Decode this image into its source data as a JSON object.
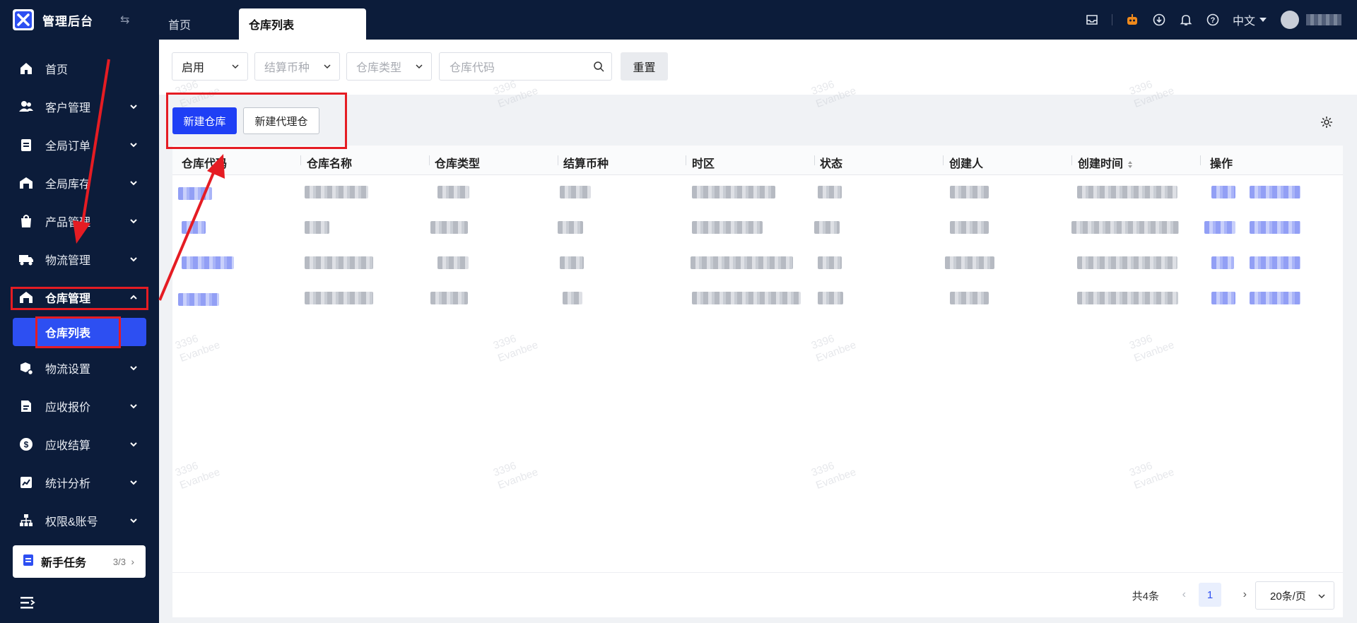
{
  "app": {
    "title": "管理后台",
    "brand_color": "#2d4ff2",
    "sidebar_color": "#0c1c3a"
  },
  "tabs": [
    {
      "label": "首页",
      "active": false
    },
    {
      "label": "仓库列表",
      "active": true
    }
  ],
  "header": {
    "icons": [
      "inbox-icon",
      "robot-icon",
      "download-icon",
      "bell-icon",
      "help-icon"
    ],
    "language": "中文"
  },
  "sidebar": {
    "items": [
      {
        "label": "首页",
        "icon": "home-icon"
      },
      {
        "label": "客户管理",
        "icon": "users-icon"
      },
      {
        "label": "全局订单",
        "icon": "clipboard-icon"
      },
      {
        "label": "全局库存",
        "icon": "warehouse-icon"
      },
      {
        "label": "产品管理",
        "icon": "bag-icon"
      },
      {
        "label": "物流管理",
        "icon": "truck-icon"
      },
      {
        "label": "仓库管理",
        "icon": "warehouse-home-icon",
        "open": true
      },
      {
        "label": "物流设置",
        "icon": "box-settings-icon"
      },
      {
        "label": "应收报价",
        "icon": "document-icon"
      },
      {
        "label": "应收结算",
        "icon": "dollar-icon"
      },
      {
        "label": "统计分析",
        "icon": "chart-icon"
      },
      {
        "label": "权限&账号",
        "icon": "org-icon"
      }
    ],
    "submenu_active": "仓库列表",
    "task_card": {
      "label": "新手任务",
      "count": "3/3"
    }
  },
  "filters": {
    "status": {
      "value": "启用"
    },
    "currency": {
      "placeholder": "结算币种"
    },
    "type": {
      "placeholder": "仓库类型"
    },
    "code": {
      "placeholder": "仓库代码"
    },
    "reset_label": "重置"
  },
  "actions": {
    "new_warehouse": "新建仓库",
    "new_agent_warehouse": "新建代理仓"
  },
  "table": {
    "columns": [
      "仓库代码",
      "仓库名称",
      "仓库类型",
      "结算币种",
      "时区",
      "状态",
      "创建人",
      "创建时间",
      "操作"
    ],
    "row_count": 4
  },
  "pagination": {
    "total": "共4条",
    "current_page": "1",
    "page_size": "20条/页"
  },
  "watermark": {
    "line1": "3396",
    "line2": "Evanbee"
  }
}
